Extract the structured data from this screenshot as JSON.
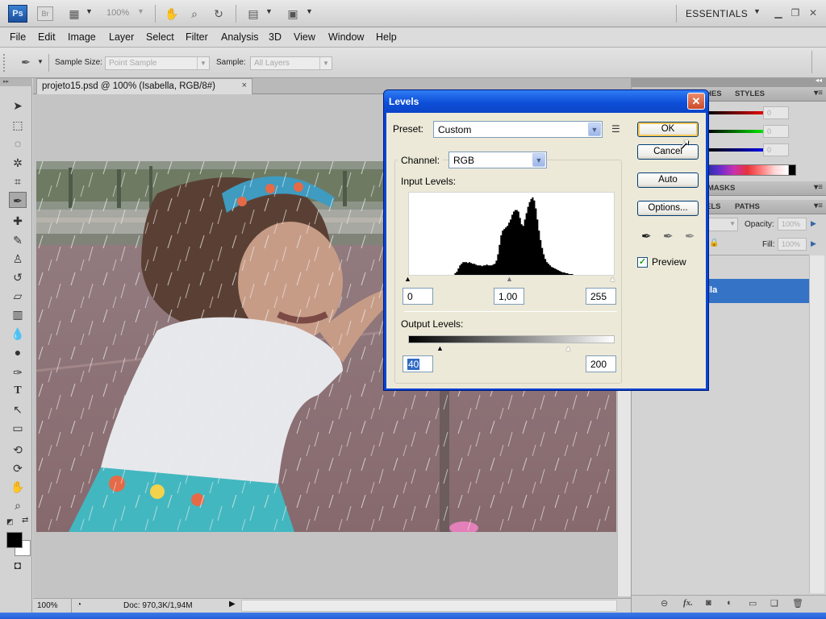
{
  "appbar": {
    "logo": "Ps",
    "bridge": "Br",
    "zoom": "100%",
    "workspace": "ESSENTIALS"
  },
  "menu": [
    "File",
    "Edit",
    "Image",
    "Layer",
    "Select",
    "Filter",
    "Analysis",
    "3D",
    "View",
    "Window",
    "Help"
  ],
  "options": {
    "sample_size_label": "Sample Size:",
    "sample_size_value": "Point Sample",
    "sample_label": "Sample:",
    "sample_value": "All Layers"
  },
  "document": {
    "tab_title": "projeto15.psd @ 100% (Isabella, RGB/8#)",
    "tab_close": "×"
  },
  "status": {
    "zoom": "100%",
    "doc_info": "Doc: 970,3K/1,94M"
  },
  "panels": {
    "tabs1": [
      "HES",
      "STYLES"
    ],
    "color_values": [
      "0",
      "0",
      "0"
    ],
    "tabs2": [
      "MASKS"
    ],
    "tabs3": [
      "ELS",
      "PATHS"
    ],
    "opacity_label": "Opacity:",
    "opacity_value": "100%",
    "fill_label": "Fill:",
    "fill_value": "100%",
    "layer_name": "lla"
  },
  "levels": {
    "title": "Levels",
    "preset_label": "Preset:",
    "preset_value": "Custom",
    "channel_label": "Channel:",
    "channel_value": "RGB",
    "input_levels_label": "Input Levels:",
    "input_black": "0",
    "input_mid": "1,00",
    "input_white": "255",
    "output_levels_label": "Output Levels:",
    "output_black": "40",
    "output_white": "200",
    "buttons": {
      "ok": "OK",
      "cancel": "Cancel",
      "auto": "Auto",
      "options": "Options..."
    },
    "preview_label": "Preview",
    "preview_checked": true,
    "histogram": [
      0,
      0,
      0,
      0,
      0,
      0,
      0,
      0,
      0,
      0,
      0,
      0,
      0,
      0,
      0,
      0,
      0,
      0,
      0,
      0,
      0,
      0,
      0,
      0,
      0,
      0,
      0,
      0,
      2,
      4,
      8,
      12,
      14,
      16,
      16,
      16,
      15,
      16,
      15,
      14,
      14,
      13,
      12,
      12,
      12,
      11,
      12,
      12,
      13,
      12,
      12,
      12,
      13,
      14,
      18,
      26,
      38,
      50,
      56,
      58,
      60,
      62,
      66,
      70,
      76,
      80,
      82,
      82,
      80,
      72,
      64,
      62,
      70,
      78,
      86,
      92,
      96,
      98,
      94,
      84,
      70,
      56,
      44,
      34,
      26,
      20,
      16,
      14,
      12,
      10,
      9,
      8,
      7,
      6,
      5,
      4,
      3,
      3,
      2,
      2,
      1,
      1,
      1,
      0,
      0,
      0,
      0,
      0,
      0,
      0,
      0,
      0,
      0,
      0,
      0,
      0,
      0,
      0,
      0,
      0,
      0,
      0,
      0,
      0,
      0,
      0,
      0,
      0
    ]
  }
}
